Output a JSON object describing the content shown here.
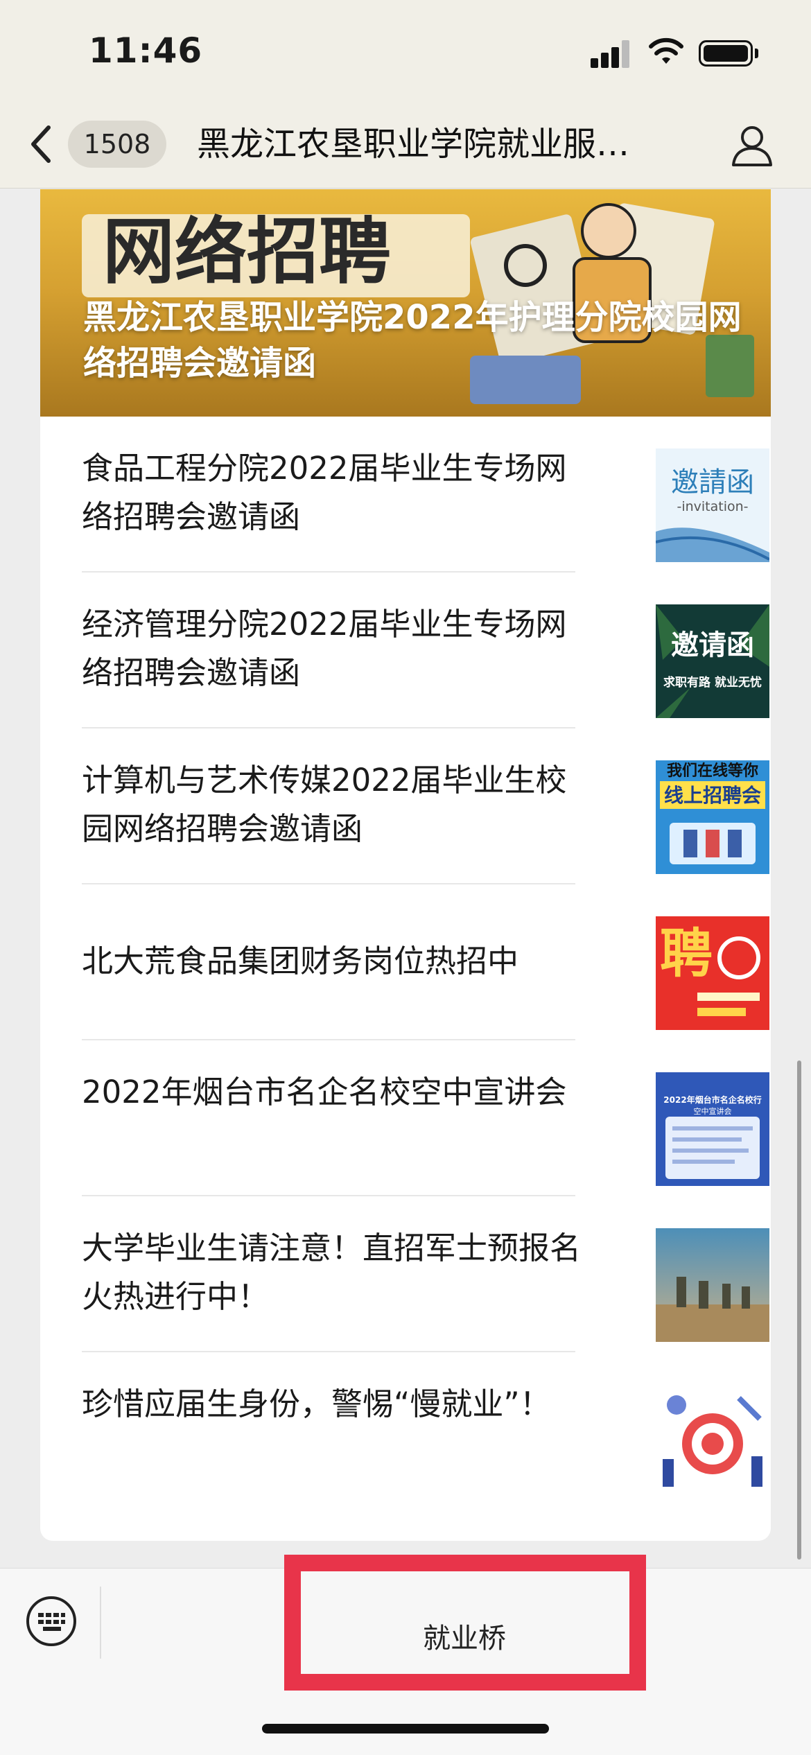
{
  "status_bar": {
    "time": "11:46"
  },
  "nav": {
    "badge": "1508",
    "title": "黑龙江农垦职业学院就业服…"
  },
  "hero": {
    "title": "黑龙江农垦职业学院2022年护理分院校园网络招聘会邀请函",
    "image_text": "网络招聘"
  },
  "articles": [
    {
      "title": "食品工程分院2022届毕业生专场网络招聘会邀请函",
      "thumb_text": "邀請函",
      "thumb_sub": "-invitation-"
    },
    {
      "title": "经济管理分院2022届毕业生专场网络招聘会邀请函",
      "thumb_text": "邀请函",
      "thumb_sub": "求职有路 就业无忧"
    },
    {
      "title": "计算机与艺术传媒2022届毕业生校园网络招聘会邀请函",
      "thumb_text": "我们在线等你",
      "thumb_sub": "线上招聘会"
    },
    {
      "title": "北大荒食品集团财务岗位热招中",
      "thumb_text": "聘",
      "thumb_sub": ""
    },
    {
      "title": "2022年烟台市名企名校空中宣讲会",
      "thumb_text": "2022年烟台市名企名校行",
      "thumb_sub": "空中宣讲会"
    },
    {
      "title": "大学毕业生请注意！直招军士预报名火热进行中！",
      "thumb_text": "",
      "thumb_sub": ""
    },
    {
      "title": "珍惜应届生身份，警惕“慢就业”！",
      "thumb_text": "",
      "thumb_sub": ""
    }
  ],
  "bottom_bar": {
    "menu_label": "就业桥"
  },
  "colors": {
    "highlight": "#e8344a",
    "hero": "#d5a031"
  }
}
